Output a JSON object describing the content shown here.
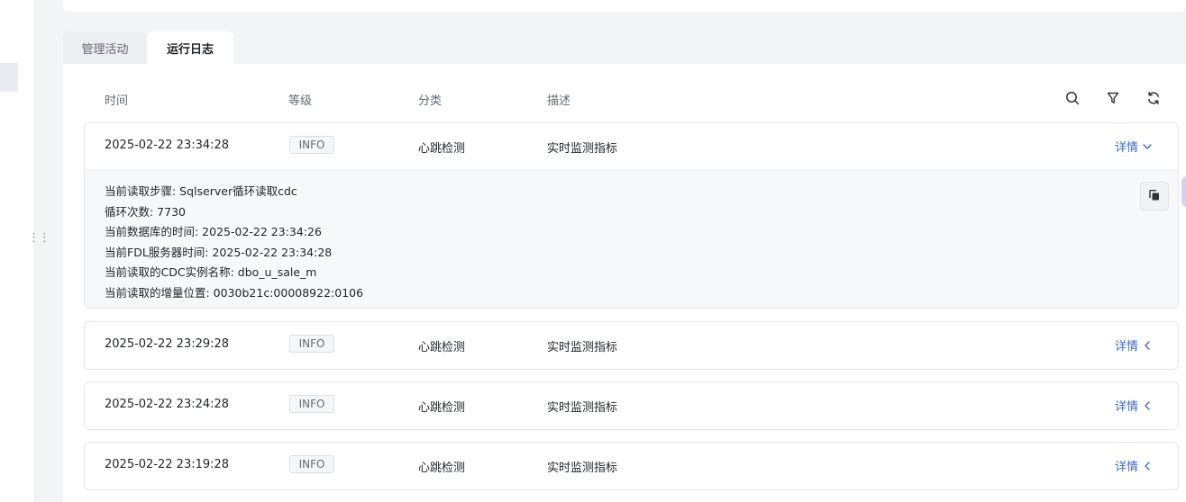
{
  "tabs": [
    {
      "label": "管理活动",
      "active": false
    },
    {
      "label": "运行日志",
      "active": true
    }
  ],
  "table": {
    "columns": {
      "time": "时间",
      "level": "等级",
      "category": "分类",
      "description": "描述"
    },
    "toolbar_icons": [
      "search-icon",
      "filter-icon",
      "refresh-icon"
    ]
  },
  "rows": [
    {
      "time": "2025-02-22 23:34:28",
      "level": "INFO",
      "category": "心跳检测",
      "description": "实时监测指标",
      "detail_label": "详情",
      "expanded": true,
      "details": [
        "当前读取步骤: Sqlserver循环读取cdc",
        "循环次数: 7730",
        "当前数据库的时间: 2025-02-22 23:34:26",
        "当前FDL服务器时间: 2025-02-22 23:34:28",
        "当前读取的CDC实例名称: dbo_u_sale_m",
        "当前读取的增量位置: 0030b21c:00008922:0106"
      ]
    },
    {
      "time": "2025-02-22 23:29:28",
      "level": "INFO",
      "category": "心跳检测",
      "description": "实时监测指标",
      "detail_label": "详情",
      "expanded": false
    },
    {
      "time": "2025-02-22 23:24:28",
      "level": "INFO",
      "category": "心跳检测",
      "description": "实时监测指标",
      "detail_label": "详情",
      "expanded": false
    },
    {
      "time": "2025-02-22 23:19:28",
      "level": "INFO",
      "category": "心跳检测",
      "description": "实时监测指标",
      "detail_label": "详情",
      "expanded": false
    }
  ],
  "colors": {
    "accent": "#3b6bcb",
    "badge_border": "#dcdfe6",
    "panel_bg": "#ffffff",
    "page_bg": "#f3f4f6"
  }
}
